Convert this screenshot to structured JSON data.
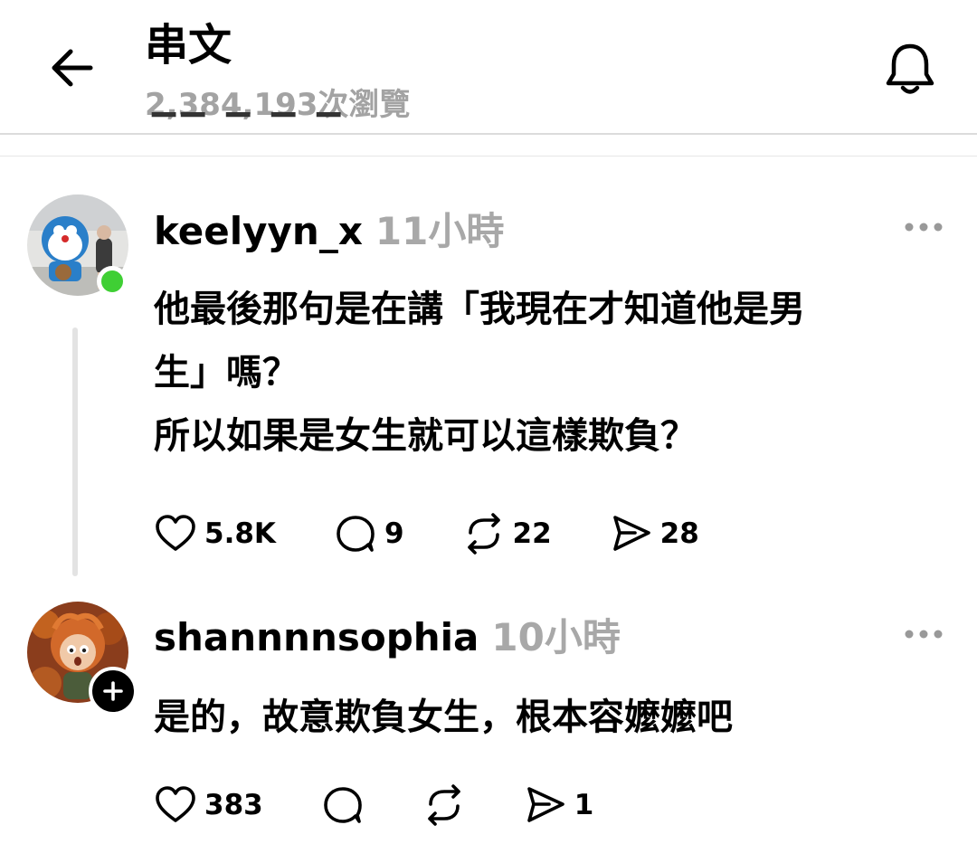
{
  "header": {
    "title": "串文",
    "views": "2,384,193次瀏覽",
    "back_icon": "arrow-left-icon",
    "bell_icon": "bell-icon"
  },
  "posts": [
    {
      "username": "keelyyn_x",
      "time": "11小時",
      "lines": [
        "他最後那句是在講「我現在才知道他是男",
        "生」嗎？",
        "所以如果是女生就可以這樣欺負？"
      ],
      "likes": "5.8K",
      "replies": "9",
      "reposts": "22",
      "shares": "28",
      "online": true
    },
    {
      "username": "shannnnsophia",
      "time": "10小時",
      "lines": [
        "是的，故意欺負女生，根本容嬤嬤吧"
      ],
      "likes": "383",
      "replies": "",
      "reposts": "",
      "shares": "1"
    }
  ],
  "colors": {
    "online": "#3fcf34",
    "muted": "#a8a8a8",
    "divider": "#dcdcdc"
  }
}
